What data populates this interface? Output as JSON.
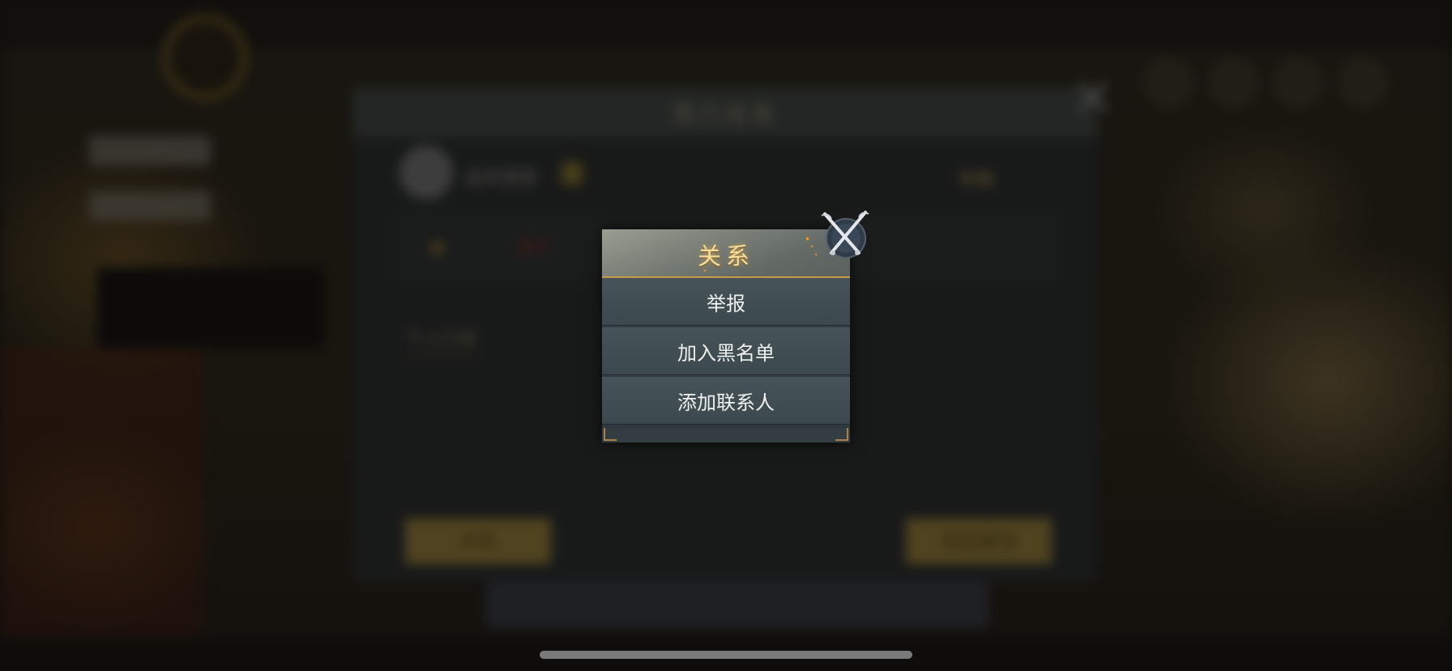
{
  "background": {
    "dialog_title": "势力信息",
    "player_name": "起风落雪",
    "report_link": "举报",
    "stat_red": "敌对",
    "tab_label": "个人介绍",
    "left_button": "关系",
    "right_button": "发起邀请"
  },
  "popup": {
    "title": "关系",
    "items": [
      {
        "label": "举报"
      },
      {
        "label": "加入黑名单"
      },
      {
        "label": "添加联系人"
      }
    ]
  },
  "icons": {
    "close": "crossed-swords-close-icon"
  },
  "colors": {
    "title_gold": "#f5dfa0",
    "accent_gold": "#c79a4a",
    "item_bg": "#46545a",
    "item_text": "#f0f0ee"
  }
}
